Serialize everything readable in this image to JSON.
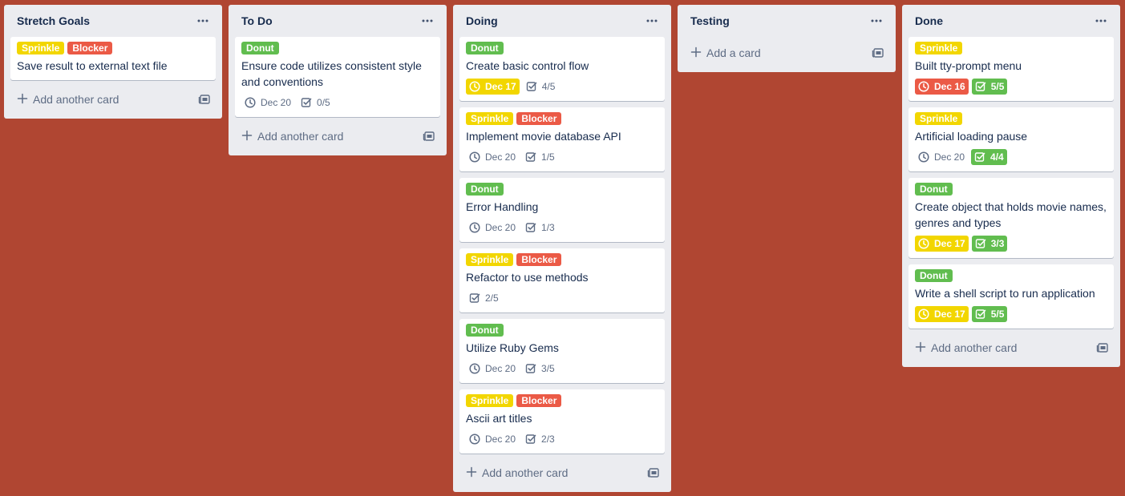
{
  "colors": {
    "board_bg": "#b04632",
    "list_bg": "#ebecf0",
    "label_sprinkle": "#f2d600",
    "label_blocker": "#eb5a46",
    "label_donut": "#61bd4f"
  },
  "lists": [
    {
      "title": "Stretch Goals",
      "add_label": "Add another card",
      "cards": [
        {
          "labels": [
            {
              "text": "Sprinkle",
              "color": "#f2d600"
            },
            {
              "text": "Blocker",
              "color": "#eb5a46"
            }
          ],
          "title": "Save result to external text file",
          "badges": []
        }
      ]
    },
    {
      "title": "To Do",
      "add_label": "Add another card",
      "cards": [
        {
          "labels": [
            {
              "text": "Donut",
              "color": "#61bd4f"
            }
          ],
          "title": "Ensure code utilizes consistent style and conventions",
          "badges": [
            {
              "kind": "due",
              "text": "Dec 20",
              "state": ""
            },
            {
              "kind": "checklist",
              "text": "0/5",
              "state": ""
            }
          ]
        }
      ]
    },
    {
      "title": "Doing",
      "add_label": "Add another card",
      "cards": [
        {
          "labels": [
            {
              "text": "Donut",
              "color": "#61bd4f"
            }
          ],
          "title": "Create basic control flow",
          "badges": [
            {
              "kind": "due",
              "text": "Dec 17",
              "state": "due-soon"
            },
            {
              "kind": "checklist",
              "text": "4/5",
              "state": ""
            }
          ]
        },
        {
          "labels": [
            {
              "text": "Sprinkle",
              "color": "#f2d600"
            },
            {
              "text": "Blocker",
              "color": "#eb5a46"
            }
          ],
          "title": "Implement movie database API",
          "badges": [
            {
              "kind": "due",
              "text": "Dec 20",
              "state": ""
            },
            {
              "kind": "checklist",
              "text": "1/5",
              "state": ""
            }
          ]
        },
        {
          "labels": [
            {
              "text": "Donut",
              "color": "#61bd4f"
            }
          ],
          "title": "Error Handling",
          "badges": [
            {
              "kind": "due",
              "text": "Dec 20",
              "state": ""
            },
            {
              "kind": "checklist",
              "text": "1/3",
              "state": ""
            }
          ]
        },
        {
          "labels": [
            {
              "text": "Sprinkle",
              "color": "#f2d600"
            },
            {
              "text": "Blocker",
              "color": "#eb5a46"
            }
          ],
          "title": "Refactor to use methods",
          "badges": [
            {
              "kind": "checklist",
              "text": "2/5",
              "state": ""
            }
          ]
        },
        {
          "labels": [
            {
              "text": "Donut",
              "color": "#61bd4f"
            }
          ],
          "title": "Utilize Ruby Gems",
          "badges": [
            {
              "kind": "due",
              "text": "Dec 20",
              "state": ""
            },
            {
              "kind": "checklist",
              "text": "3/5",
              "state": ""
            }
          ]
        },
        {
          "labels": [
            {
              "text": "Sprinkle",
              "color": "#f2d600"
            },
            {
              "text": "Blocker",
              "color": "#eb5a46"
            }
          ],
          "title": "Ascii art titles",
          "badges": [
            {
              "kind": "due",
              "text": "Dec 20",
              "state": ""
            },
            {
              "kind": "checklist",
              "text": "2/3",
              "state": ""
            }
          ]
        }
      ]
    },
    {
      "title": "Testing",
      "add_label": "Add a card",
      "cards": []
    },
    {
      "title": "Done",
      "add_label": "Add another card",
      "cards": [
        {
          "labels": [
            {
              "text": "Sprinkle",
              "color": "#f2d600"
            }
          ],
          "title": "Built tty-prompt menu",
          "badges": [
            {
              "kind": "due",
              "text": "Dec 16",
              "state": "overdue"
            },
            {
              "kind": "checklist",
              "text": "5/5",
              "state": "complete"
            }
          ]
        },
        {
          "labels": [
            {
              "text": "Sprinkle",
              "color": "#f2d600"
            }
          ],
          "title": "Artificial loading pause",
          "badges": [
            {
              "kind": "due",
              "text": "Dec 20",
              "state": ""
            },
            {
              "kind": "checklist",
              "text": "4/4",
              "state": "complete"
            }
          ]
        },
        {
          "labels": [
            {
              "text": "Donut",
              "color": "#61bd4f"
            }
          ],
          "title": "Create object that holds movie names, genres and types",
          "badges": [
            {
              "kind": "due",
              "text": "Dec 17",
              "state": "due-soon"
            },
            {
              "kind": "checklist",
              "text": "3/3",
              "state": "complete"
            }
          ]
        },
        {
          "labels": [
            {
              "text": "Donut",
              "color": "#61bd4f"
            }
          ],
          "title": "Write a shell script to run application",
          "badges": [
            {
              "kind": "due",
              "text": "Dec 17",
              "state": "due-soon"
            },
            {
              "kind": "checklist",
              "text": "5/5",
              "state": "complete"
            }
          ]
        }
      ]
    }
  ]
}
